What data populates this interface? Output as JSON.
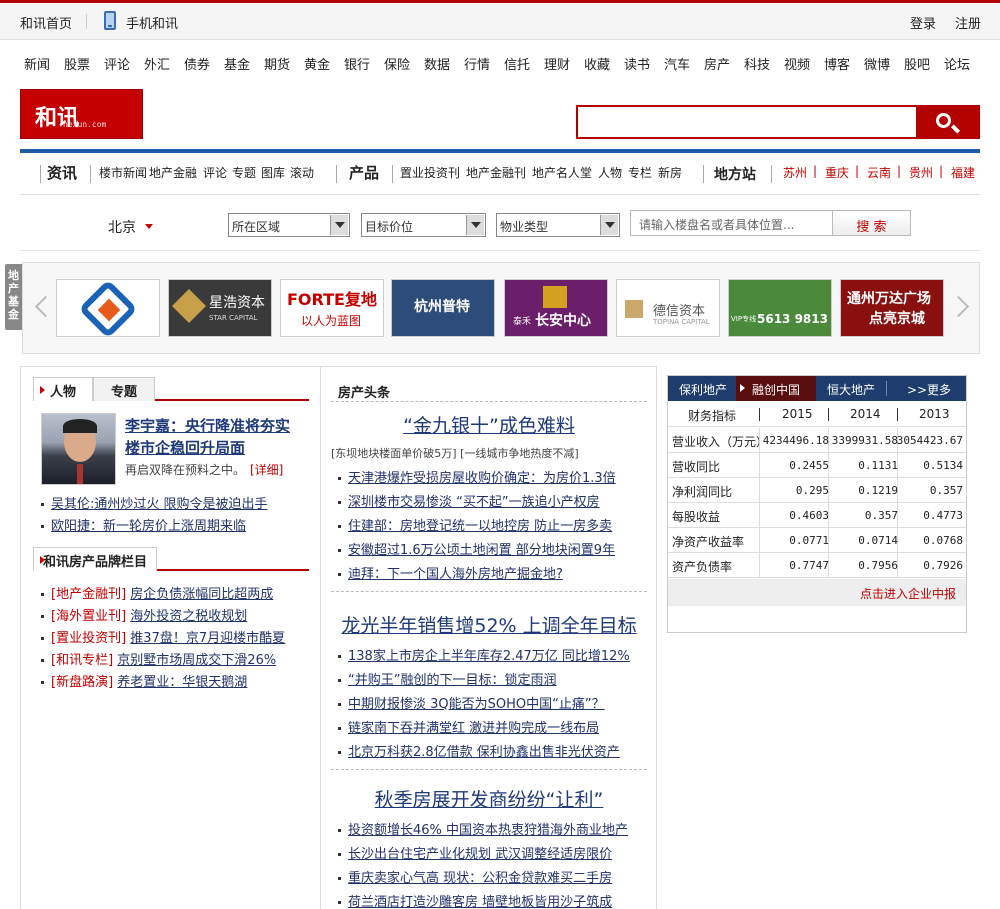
{
  "topbar": {
    "home": "和讯首页",
    "mobile": "手机和讯",
    "login": "登录",
    "register": "注册"
  },
  "nav": [
    "新闻",
    "股票",
    "评论",
    "外汇",
    "债券",
    "基金",
    "期货",
    "黄金",
    "银行",
    "保险",
    "数据",
    "行情",
    "信托",
    "理财",
    "收藏",
    "读书",
    "汽车",
    "房产",
    "科技",
    "视频",
    "博客",
    "微博",
    "股吧",
    "论坛"
  ],
  "logo": {
    "mark": "和讯",
    "sub": "hexun.com"
  },
  "channel": {
    "news_head": "资讯",
    "news_items": [
      "楼市新闻",
      "地产金融",
      "评论",
      "专题",
      "图库",
      "滚动"
    ],
    "product_head": "产品",
    "product_items": [
      "置业投资刊",
      "地产金融刊",
      "地产名人堂",
      "人物",
      "专栏",
      "新房"
    ],
    "local_head": "地方站",
    "local_items": [
      "苏州",
      "重庆",
      "云南",
      "贵州",
      "福建"
    ]
  },
  "filter": {
    "city": "北京",
    "region": "所在区域",
    "price": "目标价位",
    "type": "物业类型",
    "keyword_placeholder": "请输入楼盘名或者具体位置...",
    "search": "搜 索"
  },
  "fund": {
    "tab": "地产基金",
    "logos": [
      {
        "name": "",
        "color": "#ffffff"
      },
      {
        "name": "星浩资本",
        "sub": "STAR CAPITAL",
        "color": "#3a3a3a"
      },
      {
        "name": "FORTE复地",
        "sub": "以人为蓝图",
        "color": "#ffffff"
      },
      {
        "name": "杭州普特",
        "color": "#2e4c7a"
      },
      {
        "name": "长安中心",
        "sub": "泰禾",
        "color": "#6b1f6b"
      },
      {
        "name": "德信资本",
        "sub": "TOPINA CAPITAL",
        "color": "#ffffff"
      },
      {
        "name": "5613 9813",
        "sub": "VIP专线",
        "color": "#4a8a3a"
      },
      {
        "name": "通州万达广场",
        "sub": "点亮京城",
        "color": "#8a1010"
      }
    ]
  },
  "left": {
    "tab_people": "人物",
    "tab_topics": "专题",
    "feature_title_1": "李宇嘉：央行降准将夯实",
    "feature_title_2": "楼市企稳回升局面",
    "feature_summary": "再启双降在预料之中。",
    "feature_more": "[详细]",
    "people_links": [
      "吴其伦:通州炒过火 限购令是被迫出手",
      "欧阳捷：新一轮房价上涨周期来临"
    ],
    "brand_head": "和讯房产品牌栏目",
    "brand_items": [
      {
        "tag": "[地产金融刊]",
        "text": "房企负债涨幅同比超两成"
      },
      {
        "tag": "[海外置业刊]",
        "text": "海外投资之税收规划"
      },
      {
        "tag": "[置业投资刊]",
        "text": "推37盘！京7月迎楼市酷夏"
      },
      {
        "tag": "[和讯专栏]",
        "text": "京别墅市场周成交下滑26%"
      },
      {
        "tag": "[新盘路演]",
        "text": "养老置业：华银天鹅湖"
      }
    ]
  },
  "mid": {
    "section": "房产头条",
    "blocks": [
      {
        "headline": "“金九银十”成色难料",
        "sub": "[东坝地块楼面单价破5万]  [一线城市争地热度不减]",
        "items": [
          "天津港爆炸受损房屋收购价确定：为房价1.3倍",
          "深圳楼市交易惨淡 “买不起”一族追小产权房",
          "住建部：房地登记统一以地控房 防止一房多卖",
          "安徽超过1.6万公顷土地闲置 部分地块闲置9年",
          "迪拜：下一个国人海外房地产掘金地?"
        ]
      },
      {
        "headline": "龙光半年销售增52% 上调全年目标",
        "items": [
          "138家上市房企上半年库存2.47万亿 同比增12%",
          "“并购王”融创的下一目标：锁定雨润",
          "中期财报惨淡 3Q能否为SOHO中国“止痛”？",
          "链家南下吞并满堂红 激进并购完成一线布局",
          "北京万科获2.8亿借款 保利协鑫出售非光伏资产"
        ]
      },
      {
        "headline": "秋季房展开发商纷纷“让利”",
        "items": [
          "投资额增长46% 中国资本热衷狩猎海外商业地产",
          "长沙出台住宅产业化规划 武汉调整经适房限价",
          "重庆卖家心气高 现状：公积金贷款难买二手房",
          "荷兰酒店打造沙雕客房 墙壁地板皆用沙子筑成"
        ]
      }
    ]
  },
  "fin": {
    "tabs": [
      "保利地产",
      "融创中国",
      "恒大地产",
      ">>更多"
    ],
    "header": [
      "财务指标",
      "2015",
      "2014",
      "2013"
    ],
    "rows": [
      {
        "label": "营业收入（万元）",
        "v": [
          "4234496.18",
          "3399931.58",
          "3054423.67"
        ]
      },
      {
        "label": "营收同比",
        "v": [
          "0.2455",
          "0.1131",
          "0.5134"
        ]
      },
      {
        "label": "净利润同比",
        "v": [
          "0.295",
          "0.1219",
          "0.357"
        ]
      },
      {
        "label": "每股收益",
        "v": [
          "0.4603",
          "0.357",
          "0.4773"
        ]
      },
      {
        "label": "净资产收益率",
        "v": [
          "0.0771",
          "0.0714",
          "0.0768"
        ]
      },
      {
        "label": "资产负债率",
        "v": [
          "0.7747",
          "0.7956",
          "0.7926"
        ]
      }
    ],
    "footer": "点击进入企业中报"
  }
}
